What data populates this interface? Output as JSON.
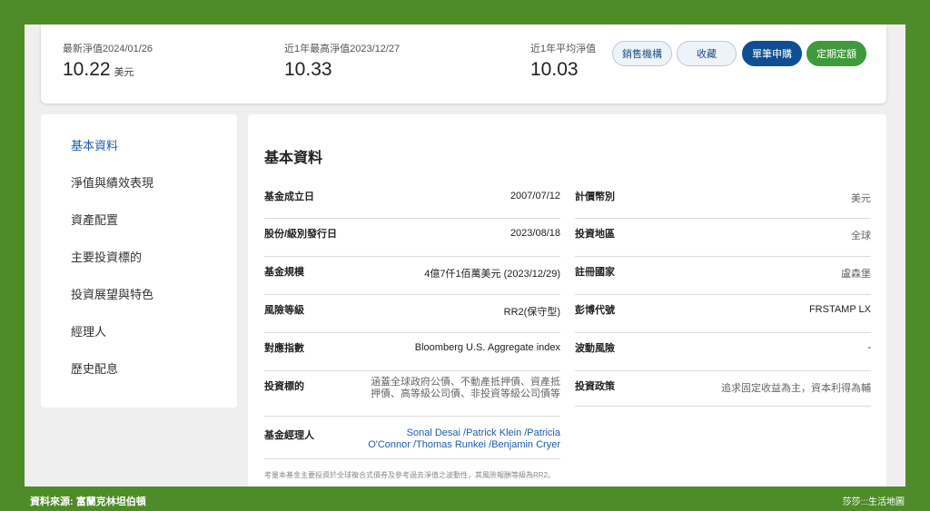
{
  "header": {
    "stats": [
      {
        "label": "最新淨值2024/01/26",
        "value": "10.22",
        "unit": "美元"
      },
      {
        "label": "近1年最高淨值2023/12/27",
        "value": "10.33",
        "unit": ""
      },
      {
        "label": "近1年平均淨值",
        "value": "10.03",
        "unit": ""
      }
    ],
    "buttons": {
      "sales": "銷售機構",
      "favorite": "收藏",
      "single_purchase": "單筆申購",
      "regular_plan": "定期定額"
    }
  },
  "sidebar": {
    "items": [
      {
        "label": "基本資料"
      },
      {
        "label": "淨值與績效表現"
      },
      {
        "label": "資產配置"
      },
      {
        "label": "主要投資標的"
      },
      {
        "label": "投資展望與特色"
      },
      {
        "label": "經理人"
      },
      {
        "label": "歷史配息"
      }
    ]
  },
  "main": {
    "title": "基本資料",
    "left_rows": [
      {
        "label": "基金成立日",
        "value": "2007/07/12"
      },
      {
        "label": "股份/級別發行日",
        "value": "2023/08/18"
      },
      {
        "label": "基金規模",
        "value": "4億7仟1佰萬美元 (2023/12/29)"
      },
      {
        "label": "風險等級",
        "value": "RR2(保守型)"
      },
      {
        "label": "對應指數",
        "value": "Bloomberg U.S. Aggregate index"
      },
      {
        "label": "投資標的",
        "value_line1": "涵蓋全球政府公債、不動產抵押債、資產抵",
        "value_line2": "押債、高等級公司債、非投資等級公司債等"
      },
      {
        "label": "基金經理人",
        "value_line1": "Sonal Desai /Patrick Klein /Patricia",
        "value_line2": "O'Connor /Thomas Runkei /Benjamin Cryer"
      }
    ],
    "right_rows": [
      {
        "label": "計價幣別",
        "value": "美元"
      },
      {
        "label": "投資地區",
        "value": "全球"
      },
      {
        "label": "註冊國家",
        "value": "盧森堡"
      },
      {
        "label": "彭博代號",
        "value": "FRSTAMP LX"
      },
      {
        "label": "波動風險",
        "value": "-"
      },
      {
        "label": "投資政策",
        "value": "追求固定收益為主，資本利得為輔"
      }
    ],
    "footnote": "考量本基金主要投資於全球複合式債券及參考過去淨值之波動性，其風險報酬等級為RR2。"
  },
  "captions": {
    "source": "資料來源: 富蘭克林坦伯頓",
    "credit": "莎莎:::生活地圖"
  }
}
